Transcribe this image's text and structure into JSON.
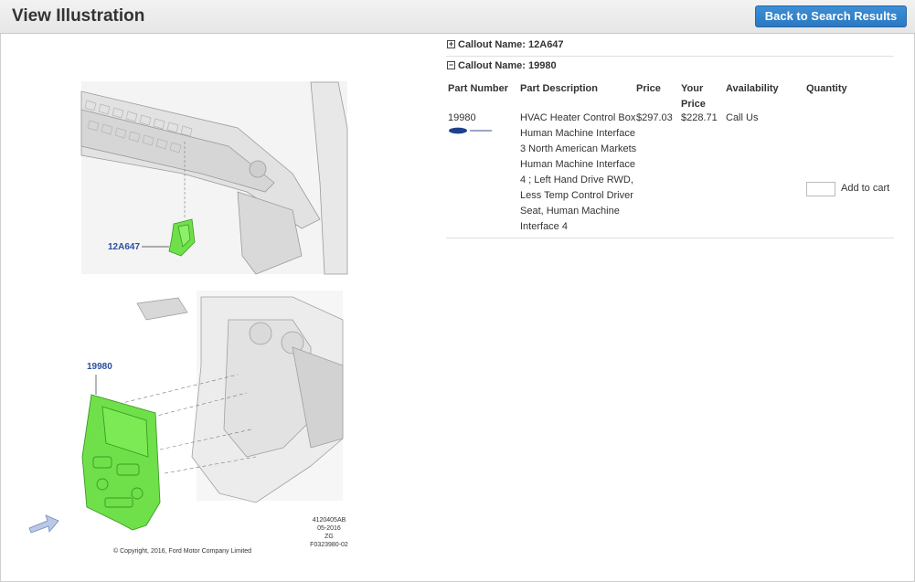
{
  "header": {
    "title": "View Illustration",
    "back_button": "Back to Search Results"
  },
  "callouts": [
    {
      "toggle": "+",
      "label": "Callout Name: 12A647"
    },
    {
      "toggle": "−",
      "label": "Callout Name: 19980"
    }
  ],
  "table": {
    "headers": {
      "part_number": "Part Number",
      "part_description": "Part Description",
      "price": "Price",
      "your_price_line1": "Your",
      "your_price_line2": "Price",
      "availability": "Availability",
      "quantity": "Quantity"
    },
    "row": {
      "part_number": "19980",
      "description_lines": [
        "HVAC Heater Control Box",
        "Human Machine Interface",
        "3 North American Markets",
        "Human Machine Interface",
        "4 ; Left Hand Drive RWD,",
        "Less Temp Control Driver",
        "Seat, Human Machine",
        "Interface 4"
      ],
      "price": "$297.03",
      "your_price": "$228.71",
      "availability": "Call Us",
      "quantity_value": "",
      "add_to_cart": "Add to cart"
    }
  },
  "illustration": {
    "callout_top": "12A647",
    "callout_bottom": "19980",
    "code_lines": [
      "4120405AB",
      "05-2016",
      "ZG",
      "F0323980-02"
    ],
    "copyright": "© Copyright, 2016, Ford Motor Company Limited",
    "highlight_color": "#6fe04a"
  }
}
